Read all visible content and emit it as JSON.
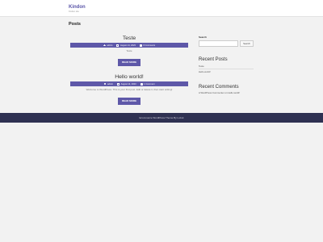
{
  "site": {
    "title": "Kindon",
    "tagline": "Kindon site"
  },
  "page_title": "Posts",
  "posts": [
    {
      "title": "Teste",
      "author": "admin",
      "date": "August 14, 2023",
      "comments": "0 Comments",
      "excerpt": "Teste",
      "read_more": "READ MORE"
    },
    {
      "title": "Hello world!",
      "author": "admin",
      "date": "August 14, 2023",
      "comments": "1 Comment",
      "excerpt": "Welcome to WordPress. This is your first post. Edit or delete it, then start writing!",
      "read_more": "READ MORE"
    }
  ],
  "sidebar": {
    "search_label": "Search",
    "search_button": "Search",
    "search_value": "",
    "recent_posts_title": "Recent Posts",
    "recent_posts": [
      "Teste",
      "Hello world!"
    ],
    "recent_comments_title": "Recent Comments",
    "recent_comment": {
      "author": "A WordPress Commenter",
      "connector": "on",
      "post": "Hello world!"
    }
  },
  "footer": {
    "text": "Ecommerce WordPress Theme By Luzuk"
  },
  "colors": {
    "accent": "#5e58a8",
    "footer_bg": "#2f3152",
    "page_bg": "#f2f2f2"
  }
}
